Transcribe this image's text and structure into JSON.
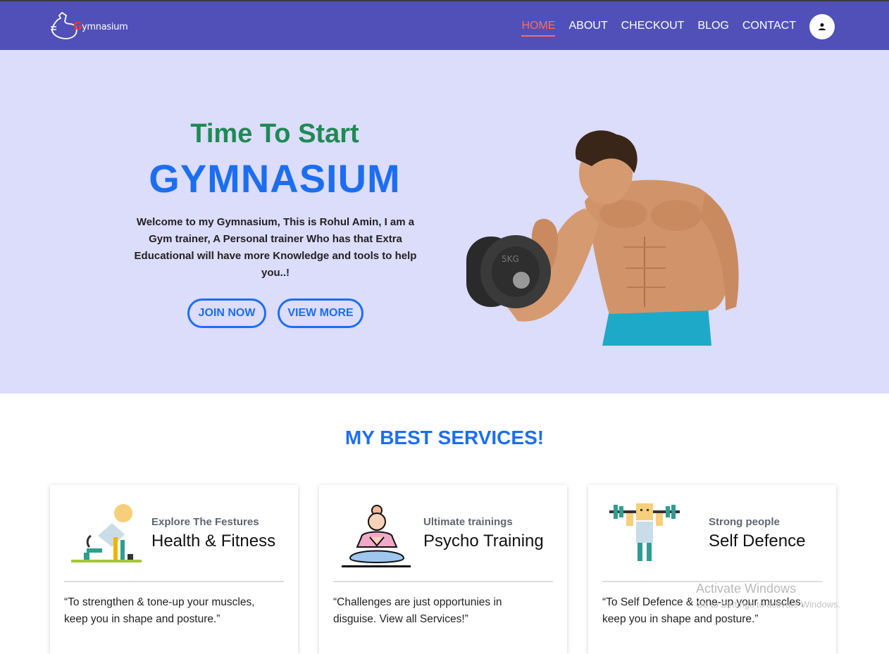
{
  "brand": {
    "logo_initial": "G",
    "logo_rest": "ymnasium"
  },
  "nav": {
    "items": [
      "HOME",
      "ABOUT",
      "CHECKOUT",
      "BLOG",
      "CONTACT"
    ],
    "active": "HOME"
  },
  "hero": {
    "subtitle": "Time To Start",
    "title": "GYMNASIUM",
    "description": "Welcome to my Gymnasium, This is Rohul Amin, I am a Gym trainer, A Personal trainer Who has that Extra Educational will have more Knowledge and tools to help you..!",
    "join_label": "JOIN NOW",
    "view_label": "VIEW MORE",
    "dumbbell_text": "5KG"
  },
  "services": {
    "title": "MY BEST SERVICES!",
    "cards": [
      {
        "kicker": "Explore The Festures",
        "heading": "Health & Fitness",
        "quote": "“To strengthen & tone-up your muscles, keep you in shape and posture.”",
        "icon": "fitness-stretch-icon"
      },
      {
        "kicker": "Ultimate trainings",
        "heading": "Psycho Training",
        "quote": "“Challenges are just opportunies in disguise. View all Services!”",
        "icon": "meditation-icon"
      },
      {
        "kicker": "Strong people",
        "heading": "Self Defence",
        "quote": "“To Self Defence & tone-up your muscles, keep you in shape and posture.”",
        "icon": "weightlifter-icon"
      }
    ]
  },
  "watermark": {
    "line1": "Activate Windows",
    "line2": "Go to Settings to activate Windows."
  },
  "colors": {
    "navbar": "#5050b8",
    "hero_bg": "#dcdcfb",
    "accent_blue": "#1c6ef0",
    "accent_green": "#1e8a54",
    "active_nav": "#ff6b5e"
  }
}
